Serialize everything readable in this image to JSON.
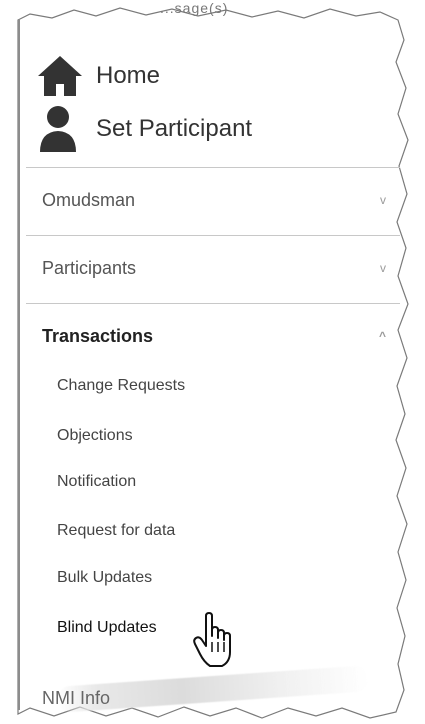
{
  "header": {
    "cut_text": "...sage(s)",
    "home_label": "Home",
    "set_participant_label": "Set Participant"
  },
  "sections": [
    {
      "label": "Omudsman",
      "chevron": "v"
    },
    {
      "label": "Participants",
      "chevron": "v"
    },
    {
      "label": "Transactions",
      "chevron": "^"
    }
  ],
  "transactions_items": [
    "Change Requests",
    "Objections",
    "Notification",
    "Request for data",
    "Bulk Updates",
    "Blind Updates"
  ],
  "bottom_partial": "NMI Info",
  "icons": {
    "home": "home-icon",
    "person": "person-icon",
    "cursor": "hand-pointer-icon"
  },
  "colors": {
    "icon": "#333333",
    "divider": "#c8c8c8"
  }
}
